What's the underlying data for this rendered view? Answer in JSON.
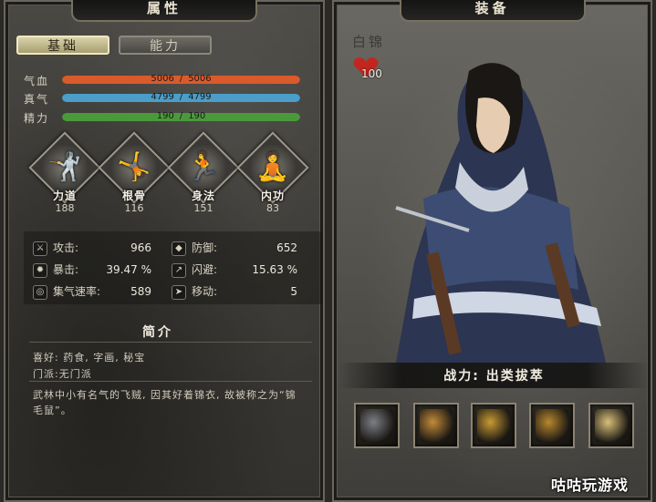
{
  "left_panel": {
    "title": "属性",
    "tabs": {
      "basic": "基础",
      "ability": "能力"
    },
    "bars": [
      {
        "label": "气血",
        "current": "5006",
        "sep": "/",
        "max": "5006",
        "fill": 1.0,
        "color": "#d95a2b"
      },
      {
        "label": "真气",
        "current": "4799",
        "sep": "/",
        "max": "4799",
        "fill": 1.0,
        "color": "#4a9ec9"
      },
      {
        "label": "精力",
        "current": "190",
        "sep": "/",
        "max": "190",
        "fill": 1.0,
        "color": "#4a9a3c"
      }
    ],
    "attributes": [
      {
        "name": "力道",
        "value": "188",
        "icon": "strength-figure-icon"
      },
      {
        "name": "根骨",
        "value": "116",
        "icon": "constitution-figure-icon"
      },
      {
        "name": "身法",
        "value": "151",
        "icon": "agility-figure-icon"
      },
      {
        "name": "内功",
        "value": "83",
        "icon": "inner-power-figure-icon"
      }
    ],
    "stats": [
      {
        "label": "攻击:",
        "value": "966",
        "icon": "sword-icon"
      },
      {
        "label": "防御:",
        "value": "652",
        "icon": "shield-icon"
      },
      {
        "label": "暴击:",
        "value": "39.47 %",
        "icon": "crit-icon"
      },
      {
        "label": "闪避:",
        "value": "15.63 %",
        "icon": "dodge-icon"
      },
      {
        "label": "集气速率:",
        "value": "589",
        "icon": "qi-icon"
      },
      {
        "label": "移动:",
        "value": "5",
        "icon": "move-icon"
      }
    ],
    "intro": {
      "title": "简介",
      "hobby": "喜好: 药食, 字画, 秘宝",
      "sect": "门派:无门派",
      "desc1": "武林中小有名气的飞贼, 因其好着锦衣, 故被称之为“锦",
      "desc2": "毛鼠”。"
    }
  },
  "right_panel": {
    "title": "装备",
    "character_name": "白锦",
    "favor": "100",
    "power_label": "战力: 出类拔萃",
    "equipment": [
      {
        "icon": "dagger-icon",
        "color": "#7d7f86"
      },
      {
        "icon": "golden-armor-icon",
        "color": "#c28b3b"
      },
      {
        "icon": "vest-armor-icon",
        "color": "#c99a34"
      },
      {
        "icon": "boots-icon",
        "color": "#b8872f"
      },
      {
        "icon": "manual-book-icon",
        "color": "#d9c07a"
      }
    ]
  },
  "watermark": "咕咕玩游戏"
}
